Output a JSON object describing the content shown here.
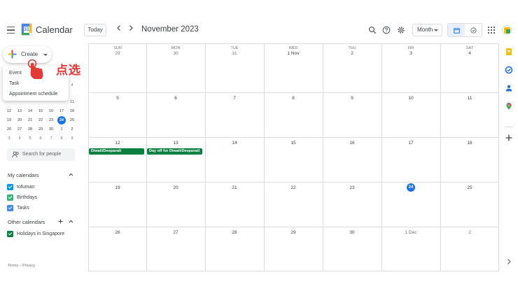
{
  "header": {
    "app_title": "Calendar",
    "logo_day": "31",
    "today_label": "Today",
    "month_title": "November 2023",
    "view_label": "Month"
  },
  "sidebar": {
    "create_label": "Create",
    "create_menu": [
      "Event",
      "Task",
      "Appointment schedule"
    ],
    "annotation_label": "点选",
    "mini_calendar": {
      "partial_row": [
        "",
        "",
        "",
        "",
        "",
        "",
        "4"
      ],
      "rows": [
        [
          "",
          "",
          "",
          "",
          "",
          "",
          "11"
        ],
        [
          "12",
          "13",
          "14",
          "15",
          "16",
          "17",
          "18"
        ],
        [
          "19",
          "20",
          "21",
          "22",
          "23",
          "24",
          "25"
        ],
        [
          "26",
          "27",
          "28",
          "29",
          "30",
          "1",
          "2"
        ],
        [
          "3",
          "4",
          "5",
          "6",
          "7",
          "8",
          "9"
        ]
      ],
      "selected": "24"
    },
    "search_placeholder": "Search for people",
    "my_calendars_title": "My calendars",
    "my_calendars": [
      {
        "name": "tofuman",
        "color": "#039be5"
      },
      {
        "name": "Birthdays",
        "color": "#33b679"
      },
      {
        "name": "Tasks",
        "color": "#4285f4"
      }
    ],
    "other_calendars_title": "Other calendars",
    "other_calendars": [
      {
        "name": "Holidays in Singapore",
        "color": "#0b8043"
      }
    ],
    "footer": "Terms – Privacy"
  },
  "calendar": {
    "days_of_week": [
      "SUN",
      "MON",
      "TUE",
      "WED",
      "THU",
      "FRI",
      "SAT"
    ],
    "weeks": [
      [
        "29",
        "30",
        "31",
        "1 Nov",
        "2",
        "3",
        "4"
      ],
      [
        "5",
        "6",
        "7",
        "8",
        "9",
        "10",
        "11"
      ],
      [
        "12",
        "13",
        "14",
        "15",
        "16",
        "17",
        "18"
      ],
      [
        "19",
        "20",
        "21",
        "22",
        "23",
        "24",
        "25"
      ],
      [
        "26",
        "27",
        "28",
        "29",
        "30",
        "1 Dec",
        "2"
      ]
    ],
    "today": "24",
    "events": [
      {
        "title": "Diwali/Deepavali",
        "day": "12",
        "color": "#0b8043"
      },
      {
        "title": "Day off for Diwali/Deepavali",
        "day": "13",
        "color": "#0b8043"
      }
    ]
  }
}
